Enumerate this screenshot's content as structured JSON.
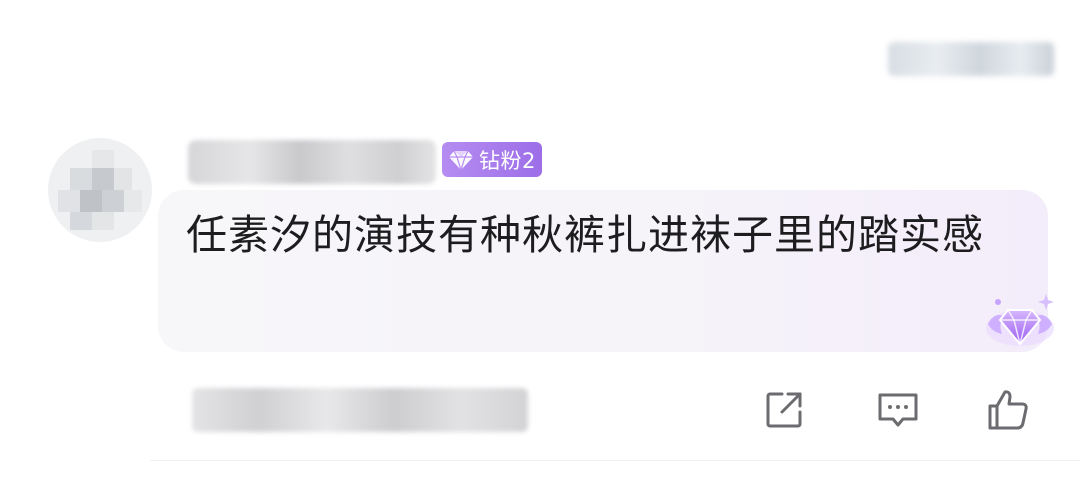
{
  "comment": {
    "badge_label": "钻粉2",
    "text": "任素汐的演技有种秋裤扎进袜子里的踏实感"
  },
  "icons": {
    "badge_icon": "diamond-icon",
    "emblem_icon": "diamond-emblem-icon",
    "share_icon": "share-icon",
    "reply_icon": "comment-icon",
    "like_icon": "thumbs-up-icon"
  },
  "colors": {
    "badge_bg": "#a77bed",
    "text": "#1d1d1f",
    "icon_stroke": "#6b6b70",
    "bubble_bg": "#f6f4f9"
  }
}
